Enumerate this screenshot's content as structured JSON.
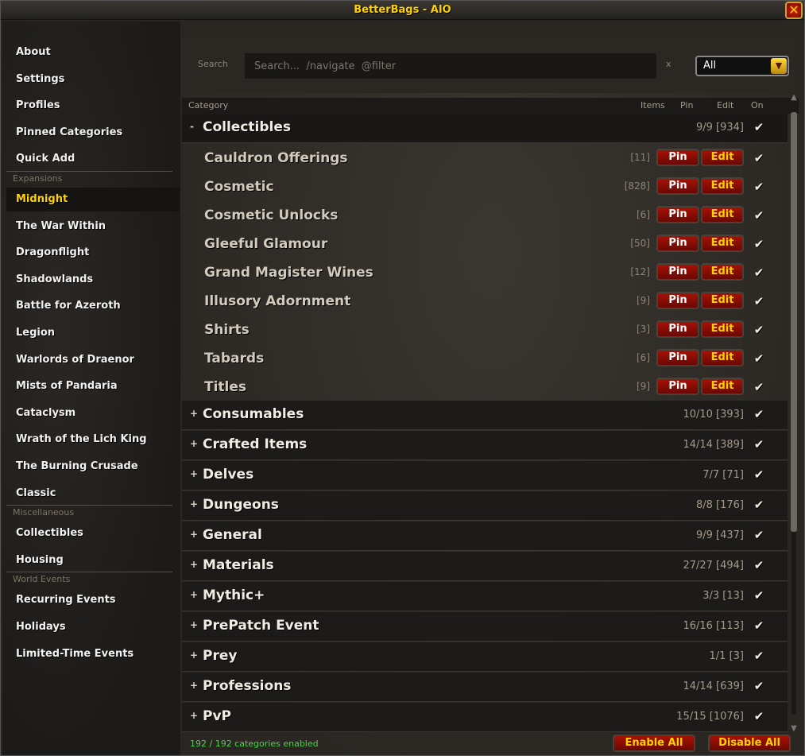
{
  "window": {
    "title": "BetterBags - AIO",
    "close_glyph": "✕"
  },
  "sidebar": {
    "top_items": [
      {
        "label": "About"
      },
      {
        "label": "Settings"
      },
      {
        "label": "Profiles"
      },
      {
        "label": "Pinned Categories"
      },
      {
        "label": "Quick Add"
      }
    ],
    "sections": [
      {
        "header": "Expansions",
        "items": [
          {
            "label": "Midnight",
            "active": true
          },
          {
            "label": "The War Within"
          },
          {
            "label": "Dragonflight"
          },
          {
            "label": "Shadowlands"
          },
          {
            "label": "Battle for Azeroth"
          },
          {
            "label": "Legion"
          },
          {
            "label": "Warlords of Draenor"
          },
          {
            "label": "Mists of Pandaria"
          },
          {
            "label": "Cataclysm"
          },
          {
            "label": "Wrath of the Lich King"
          },
          {
            "label": "The Burning Crusade"
          },
          {
            "label": "Classic"
          }
        ]
      },
      {
        "header": "Miscellaneous",
        "items": [
          {
            "label": "Collectibles"
          },
          {
            "label": "Housing"
          }
        ]
      },
      {
        "header": "World Events",
        "items": [
          {
            "label": "Recurring Events"
          },
          {
            "label": "Holidays"
          },
          {
            "label": "Limited-Time Events"
          }
        ]
      }
    ]
  },
  "search": {
    "label": "Search",
    "placeholder": "Search...  /navigate  @filter",
    "clear_label": "x",
    "filter_value": "All",
    "filter_arrow": "▼"
  },
  "columns": {
    "category": "Category",
    "items": "Items",
    "pin": "Pin",
    "edit": "Edit",
    "on": "On"
  },
  "check_glyph": "✔",
  "pin_label": "Pin",
  "edit_label": "Edit",
  "groups": [
    {
      "toggle": "-",
      "name": "Collectibles",
      "count": "9/9  [934]",
      "open": true,
      "children": [
        {
          "name": "Cauldron Offerings",
          "count": "[11]"
        },
        {
          "name": "Cosmetic",
          "count": "[828]"
        },
        {
          "name": "Cosmetic Unlocks",
          "count": "[6]"
        },
        {
          "name": "Gleeful Glamour",
          "count": "[50]"
        },
        {
          "name": "Grand Magister Wines",
          "count": "[12]"
        },
        {
          "name": "Illusory Adornment",
          "count": "[9]"
        },
        {
          "name": "Shirts",
          "count": "[3]"
        },
        {
          "name": "Tabards",
          "count": "[6]"
        },
        {
          "name": "Titles",
          "count": "[9]"
        }
      ]
    },
    {
      "toggle": "+",
      "name": "Consumables",
      "count": "10/10  [393]"
    },
    {
      "toggle": "+",
      "name": "Crafted Items",
      "count": "14/14  [389]"
    },
    {
      "toggle": "+",
      "name": "Delves",
      "count": "7/7  [71]"
    },
    {
      "toggle": "+",
      "name": "Dungeons",
      "count": "8/8  [176]"
    },
    {
      "toggle": "+",
      "name": "General",
      "count": "9/9  [437]"
    },
    {
      "toggle": "+",
      "name": "Materials",
      "count": "27/27  [494]"
    },
    {
      "toggle": "+",
      "name": "Mythic+",
      "count": "3/3  [13]"
    },
    {
      "toggle": "+",
      "name": "PrePatch Event",
      "count": "16/16  [113]"
    },
    {
      "toggle": "+",
      "name": "Prey",
      "count": "1/1  [3]"
    },
    {
      "toggle": "+",
      "name": "Professions",
      "count": "14/14  [639]"
    },
    {
      "toggle": "+",
      "name": "PvP",
      "count": "15/15  [1076]"
    }
  ],
  "footer": {
    "status": "192 / 192 categories enabled",
    "enable_all": "Enable All",
    "disable_all": "Disable All"
  },
  "scroll": {
    "up": "▲",
    "down": "▼"
  },
  "colors": {
    "accent_gold": "#ffd100",
    "button_red": "#a51206",
    "status_green": "#4fd14f"
  }
}
